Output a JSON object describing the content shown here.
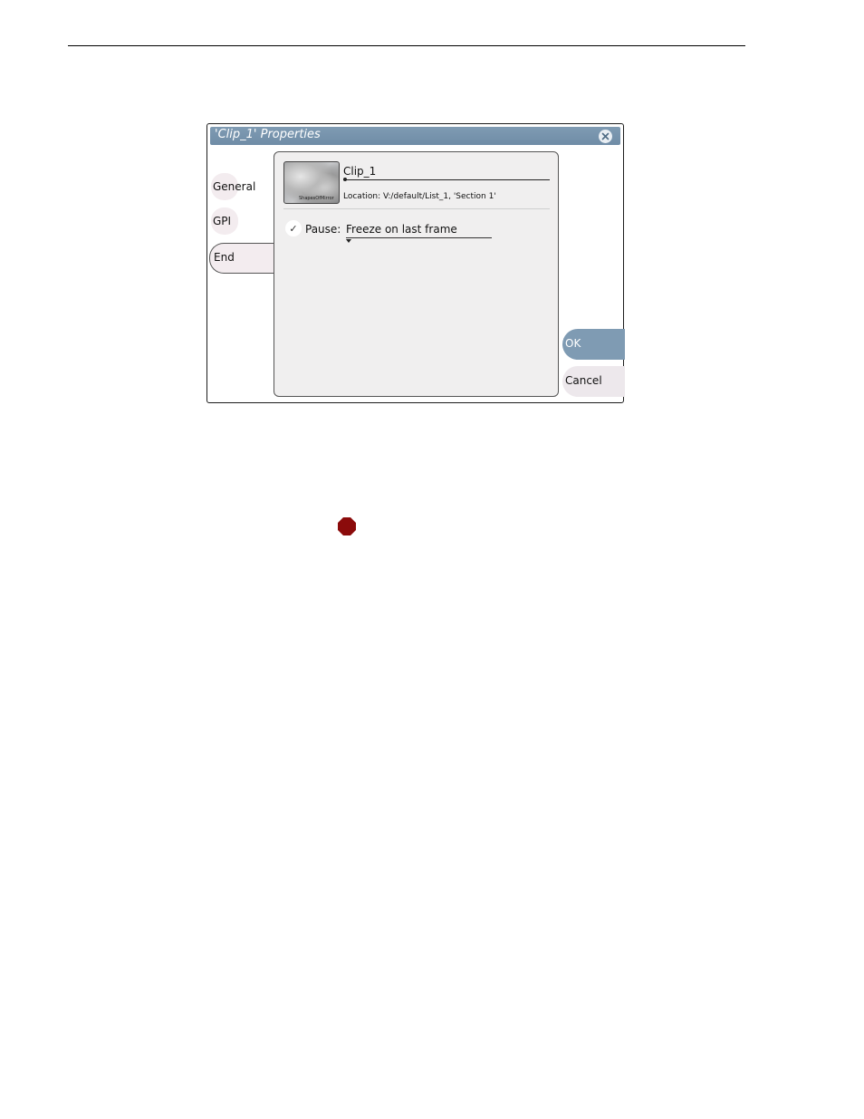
{
  "dialog": {
    "title": "'Clip_1' Properties",
    "close_icon": "close-icon",
    "tabs": [
      {
        "label": "General",
        "active": false
      },
      {
        "label": "GPI",
        "active": false
      },
      {
        "label": "End",
        "active": true
      }
    ],
    "clip": {
      "name": "Clip_1",
      "location": "Location: V:/default/List_1, 'Section 1'",
      "thumbnail_caption": "ShapesOfMirror"
    },
    "pause": {
      "checked": true,
      "label": "Pause:",
      "value": "Freeze on last frame"
    },
    "buttons": {
      "ok": "OK",
      "cancel": "Cancel"
    }
  },
  "page_icon": "stop-octagon-icon",
  "colors": {
    "titlebar": "#7f9bb3",
    "stop_icon": "#8b0b0b",
    "panel": "#f0efef",
    "tab_bubble": "#f3ecef"
  }
}
